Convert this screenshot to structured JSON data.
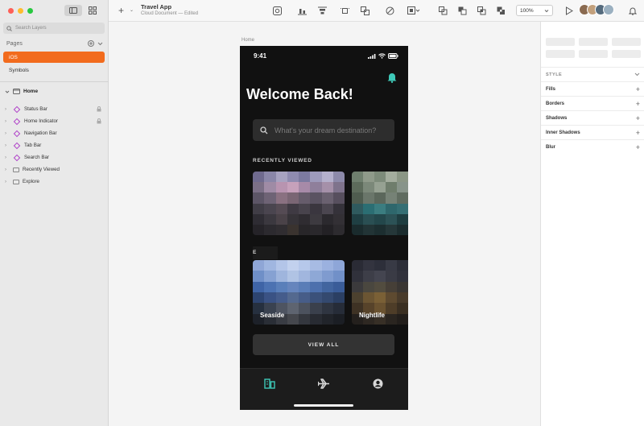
{
  "sidebar": {
    "search_placeholder": "Search Layers",
    "pages_label": "Pages",
    "pages": [
      {
        "label": "iOS",
        "active": true
      },
      {
        "label": "Symbols",
        "active": false
      }
    ],
    "artboard": "Home",
    "layers": [
      {
        "label": "Status Bar",
        "type": "symbol",
        "locked": true
      },
      {
        "label": "Home Indicator",
        "type": "symbol",
        "locked": true
      },
      {
        "label": "Navigation Bar",
        "type": "symbol",
        "locked": false
      },
      {
        "label": "Tab Bar",
        "type": "symbol",
        "locked": false
      },
      {
        "label": "Search Bar",
        "type": "symbol",
        "locked": false
      },
      {
        "label": "Recently Viewed",
        "type": "group",
        "locked": false
      },
      {
        "label": "Explore",
        "type": "group",
        "locked": false
      }
    ]
  },
  "toolbar": {
    "doc_title": "Travel App",
    "doc_subtitle": "Cloud Document — Edited",
    "zoom": "100%"
  },
  "canvas": {
    "artboard_label": "Home"
  },
  "phone": {
    "time": "9:41",
    "welcome": "Welcome Back!",
    "search_placeholder": "What's your dream destination?",
    "recently_viewed_label": "RECENTLY VIEWED",
    "explore_label": "E",
    "explore_cards": [
      {
        "label": "Seaside"
      },
      {
        "label": "Nightlife"
      }
    ],
    "view_all": "VIEW ALL",
    "accent_color": "#3ec9b8"
  },
  "inspector": {
    "style_label": "STYLE",
    "sections": [
      "Fills",
      "Borders",
      "Shadows",
      "Inner Shadows",
      "Blur"
    ]
  }
}
